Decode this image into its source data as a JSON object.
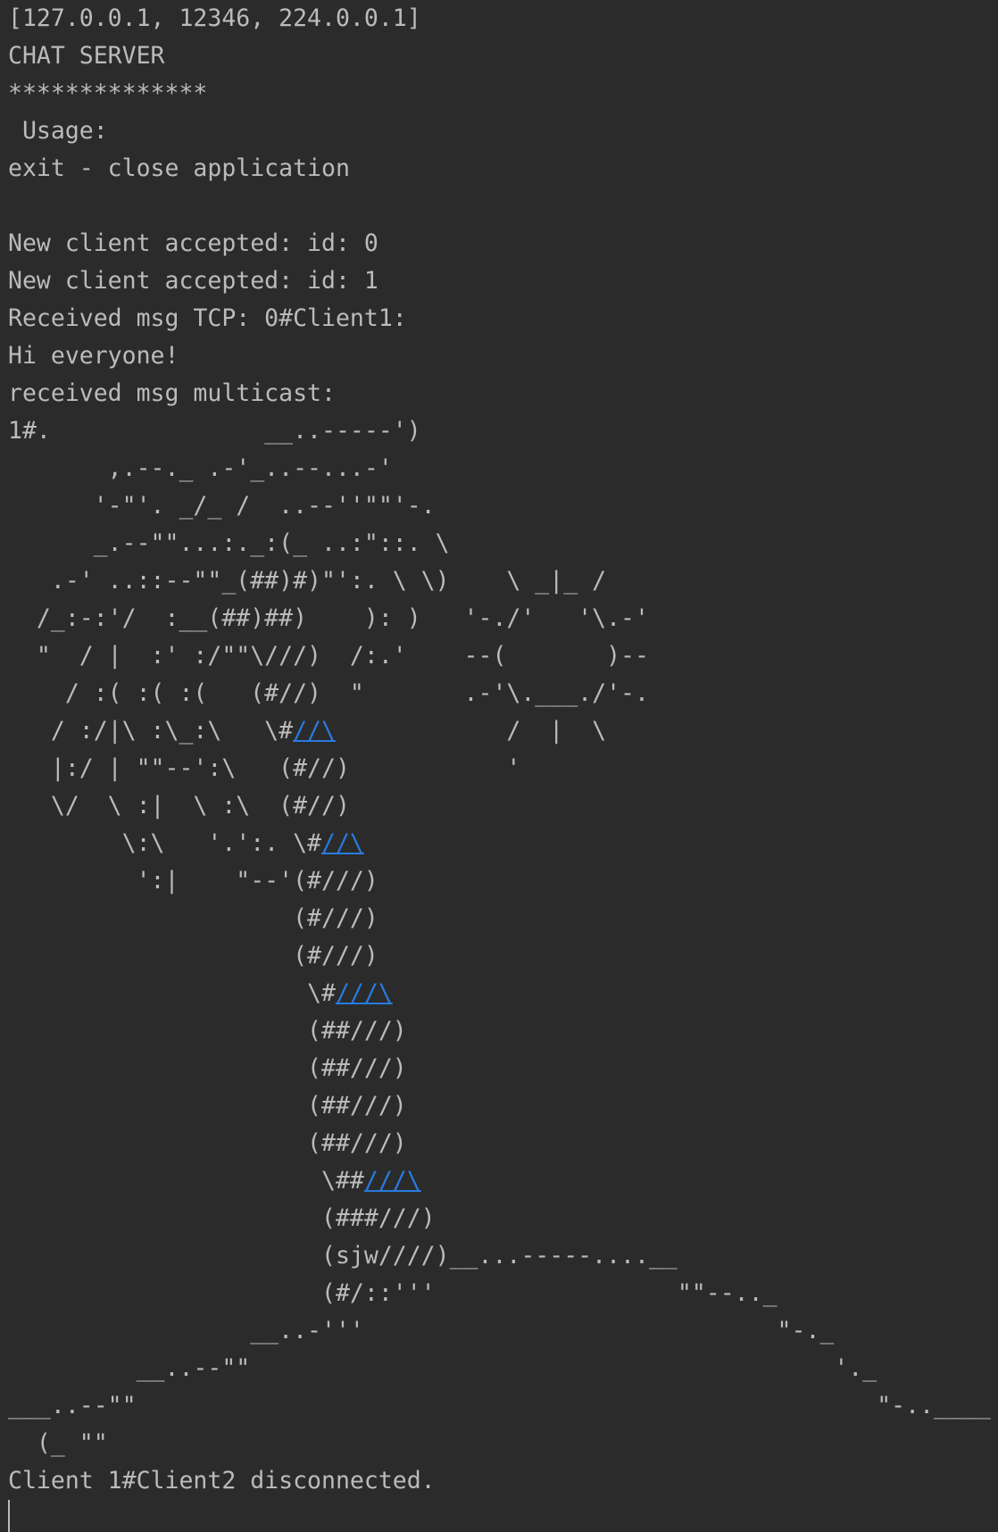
{
  "console": {
    "link_color": "#287bde",
    "text_color": "#bbbbbb",
    "background_color": "#2b2b2b",
    "lines": [
      [
        {
          "t": "[127.0.0.1, 12346, 224.0.0.1]"
        }
      ],
      [
        {
          "t": "CHAT SERVER"
        }
      ],
      [
        {
          "t": "**************"
        }
      ],
      [
        {
          "t": " Usage:"
        }
      ],
      [
        {
          "t": "exit - close application"
        }
      ],
      [
        {
          "t": ""
        }
      ],
      [
        {
          "t": "New client accepted: id: 0"
        }
      ],
      [
        {
          "t": "New client accepted: id: 1"
        }
      ],
      [
        {
          "t": "Received msg TCP: 0#Client1:"
        }
      ],
      [
        {
          "t": "Hi everyone!"
        }
      ],
      [
        {
          "t": "received msg multicast:"
        }
      ],
      [
        {
          "t": "1#.               __..-----')"
        }
      ],
      [
        {
          "t": "       ,.--._ .-'_..--...-'"
        }
      ],
      [
        {
          "t": "      '-\"'. _/_ /  ..--''\"\"'-."
        }
      ],
      [
        {
          "t": "      _.--\"\"...:._:(_ ..:\"::. \\"
        }
      ],
      [
        {
          "t": "   .-' ..::--\"\"_(##)#)\"':. \\ \\)    \\ _|_ /"
        }
      ],
      [
        {
          "t": "  /_:-:'/  :__(##)##)    ): )   '-./'   '\\.-'"
        }
      ],
      [
        {
          "t": "  \"  / |  :' :/\"\"\\///)  /:.'    --(       )--"
        }
      ],
      [
        {
          "t": "    / :( :( :(   (#//)  \"       .-'\\.___./'-."
        }
      ],
      [
        {
          "t": "   / :/|\\ :\\_:\\   \\#"
        },
        {
          "t": "//\\",
          "link": true
        },
        {
          "t": "            /  |  \\"
        }
      ],
      [
        {
          "t": "   |:/ | \"\"--':\\   (#//)           '"
        }
      ],
      [
        {
          "t": "   \\/  \\ :|  \\ :\\  (#//)"
        }
      ],
      [
        {
          "t": "        \\:\\   '.':. \\#"
        },
        {
          "t": "//\\",
          "link": true
        }
      ],
      [
        {
          "t": "         ':|    \"--'(#///)"
        }
      ],
      [
        {
          "t": "                    (#///)"
        }
      ],
      [
        {
          "t": "                    (#///)"
        }
      ],
      [
        {
          "t": "                     \\#"
        },
        {
          "t": "///\\",
          "link": true
        }
      ],
      [
        {
          "t": "                     (##///)"
        }
      ],
      [
        {
          "t": "                     (##///)"
        }
      ],
      [
        {
          "t": "                     (##///)"
        }
      ],
      [
        {
          "t": "                     (##///)"
        }
      ],
      [
        {
          "t": "                      \\##"
        },
        {
          "t": "///\\",
          "link": true
        }
      ],
      [
        {
          "t": "                      (###///)"
        }
      ],
      [
        {
          "t": "                      (sjw////)__...-----....__"
        }
      ],
      [
        {
          "t": "                      (#/::'''                 \"\"--.._"
        }
      ],
      [
        {
          "t": "                 __..-'''                             \"-._"
        }
      ],
      [
        {
          "t": "         __..--\"\"                                         '._"
        }
      ],
      [
        {
          "t": "___..--\"\"                                                    \"-..____"
        }
      ],
      [
        {
          "t": "  (_ \"\""
        }
      ],
      [
        {
          "t": "Client 1#Client2 disconnected."
        }
      ]
    ]
  }
}
